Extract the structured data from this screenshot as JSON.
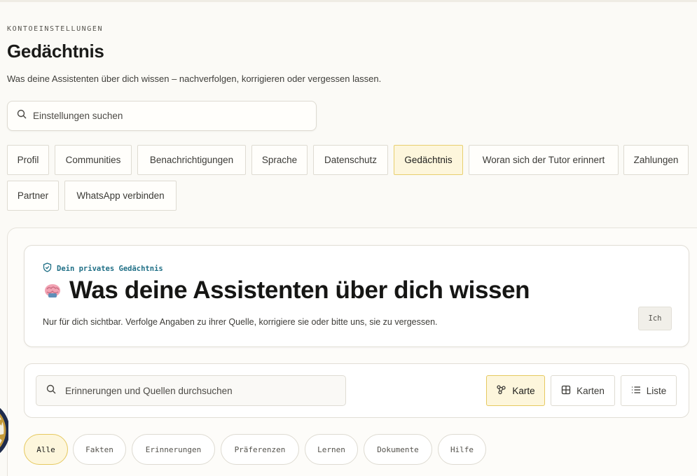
{
  "header": {
    "eyebrow": "KONTOEINSTELLUNGEN",
    "title": "Gedächtnis",
    "subtitle": "Was deine Assistenten über dich wissen – nachverfolgen, korrigieren oder vergessen lassen."
  },
  "settings_search": {
    "placeholder": "Einstellungen suchen",
    "icon": "search-icon"
  },
  "tabs": [
    {
      "label": "Profil"
    },
    {
      "label": "Communities"
    },
    {
      "label": "Benachrichtigungen"
    },
    {
      "label": "Sprache"
    },
    {
      "label": "Datenschutz"
    },
    {
      "label": "Gedächtnis",
      "active": true
    },
    {
      "label": "Woran sich der Tutor erinnert"
    },
    {
      "label": "Zahlungen"
    },
    {
      "label": "Partner"
    },
    {
      "label": "WhatsApp verbinden"
    }
  ],
  "hero": {
    "badge": "Dein privates Gedächtnis",
    "badge_icon": "shield-check-icon",
    "title": "Was deine Assistenten über dich wissen",
    "title_icon": "brain-icon",
    "description": "Nur für dich sichtbar. Verfolge Angaben zu ihrer Quelle, korrigiere sie oder bitte uns, sie zu vergessen.",
    "me_button": "Ich"
  },
  "memory_search": {
    "placeholder": "Erinnerungen und Quellen durchsuchen",
    "icon": "search-icon"
  },
  "views": [
    {
      "label": "Karte",
      "icon": "graph-icon",
      "active": true
    },
    {
      "label": "Karten",
      "icon": "grid-icon"
    },
    {
      "label": "Liste",
      "icon": "list-icon"
    }
  ],
  "filters": [
    {
      "label": "Alle",
      "active": true
    },
    {
      "label": "Fakten"
    },
    {
      "label": "Erinnerungen"
    },
    {
      "label": "Präferenzen"
    },
    {
      "label": "Lernen"
    },
    {
      "label": "Dokumente"
    },
    {
      "label": "Hilfe"
    }
  ],
  "colors": {
    "accent_fill": "#fdf6dc",
    "accent_border": "#e6c960",
    "badge_teal": "#1f6f86",
    "background": "#fbfaf6"
  }
}
